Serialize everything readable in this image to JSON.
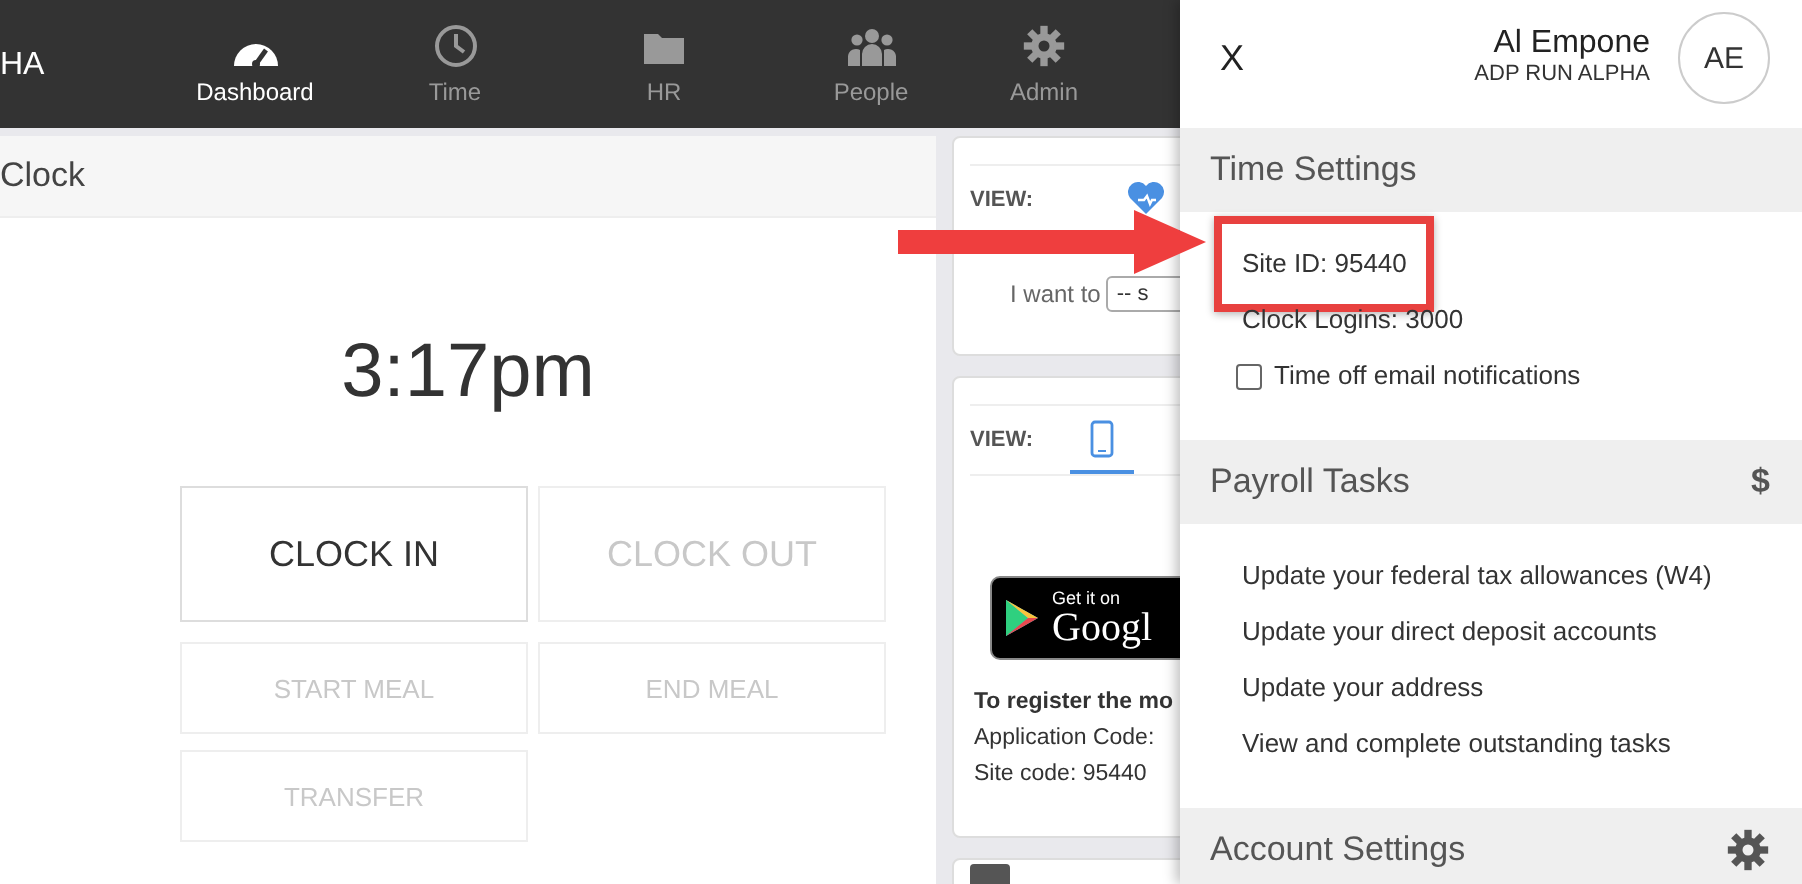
{
  "brand": "HA",
  "nav": [
    {
      "label": "Dashboard",
      "selected": true
    },
    {
      "label": "Time",
      "selected": false
    },
    {
      "label": "HR",
      "selected": false
    },
    {
      "label": "People",
      "selected": false
    },
    {
      "label": "Admin",
      "selected": false
    }
  ],
  "clock": {
    "title": "Clock",
    "time": "3:17pm",
    "buttons": [
      {
        "label": "CLOCK IN",
        "kind": "main",
        "disabled": false
      },
      {
        "label": "CLOCK OUT",
        "kind": "main",
        "disabled": true
      },
      {
        "label": "START MEAL",
        "kind": "minor",
        "disabled": true
      },
      {
        "label": "END MEAL",
        "kind": "minor",
        "disabled": true
      },
      {
        "label": "TRANSFER",
        "kind": "minor",
        "disabled": true
      }
    ]
  },
  "cards": [
    {
      "kind": "health",
      "view_label": "VIEW:",
      "prompt": "I want to",
      "select_value": "-- s"
    },
    {
      "kind": "mobile",
      "view_label": "VIEW:",
      "badge_small": "Get it on",
      "badge_large": "Googl",
      "instructions": "To register the mo",
      "lines": [
        "Application Code:",
        "Site code: 95440"
      ]
    },
    {
      "kind": "stub"
    }
  ],
  "drawer": {
    "close": "X",
    "user_name": "Al Empone",
    "company": "ADP RUN ALPHA",
    "initials": "AE",
    "sections": [
      {
        "kind": "time",
        "title": "Time Settings",
        "items": [
          {
            "kind": "text",
            "text": "Site ID: 95440",
            "highlighted": true
          },
          {
            "kind": "text",
            "text": "Clock Logins: 3000",
            "highlighted": false
          },
          {
            "kind": "checkbox",
            "text": "Time off email notifications",
            "checked": false,
            "highlighted": false
          }
        ]
      },
      {
        "kind": "tasks",
        "title": "Payroll Tasks",
        "badge": "$",
        "items": [
          {
            "kind": "link",
            "text": "Update your federal tax allowances (W4)",
            "highlighted": false
          },
          {
            "kind": "link",
            "text": "Update your direct deposit accounts",
            "highlighted": false
          },
          {
            "kind": "link",
            "text": "Update your address",
            "highlighted": false
          },
          {
            "kind": "link",
            "text": "View and complete outstanding tasks",
            "highlighted": false
          }
        ]
      },
      {
        "kind": "settings",
        "title": "Account Settings"
      }
    ]
  }
}
